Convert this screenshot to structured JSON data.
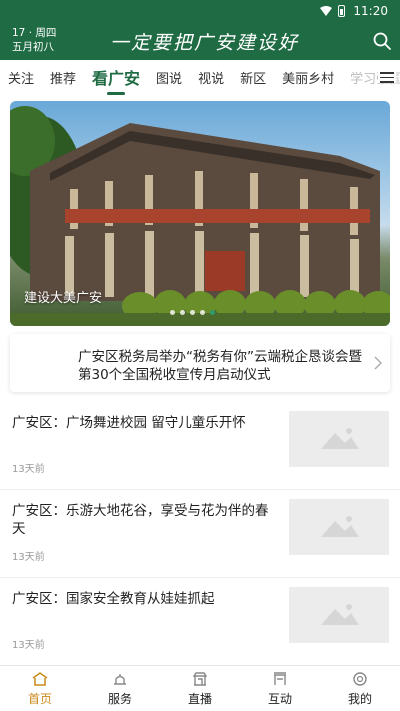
{
  "status_bar": {
    "time": "11:20"
  },
  "header": {
    "date_line1": "17 · 周四",
    "date_line2": "五月初八",
    "slogan": "一定要把广安建设好",
    "search_icon": "search-icon"
  },
  "tabs": [
    {
      "label": "关注"
    },
    {
      "label": "推荐"
    },
    {
      "label": "看广安",
      "active": true
    },
    {
      "label": "图说"
    },
    {
      "label": "视说"
    },
    {
      "label": "新区"
    },
    {
      "label": "美丽乡村"
    },
    {
      "label": "学习强国"
    }
  ],
  "banner": {
    "caption": "建设大美广安",
    "dots": 5,
    "active_dot": 4
  },
  "headline": {
    "text": "广安区税务局举办“税务有你”云端税企恳谈会暨第30个全国税收宣传月启动仪式"
  },
  "news": [
    {
      "title": "广安区：广场舞进校园  留守儿童乐开怀",
      "time": "13天前"
    },
    {
      "title": "广安区：乐游大地花谷，享受与花为伴的春天",
      "time": "13天前"
    },
    {
      "title": "广安区：国家安全教育从娃娃抓起",
      "time": "13天前"
    }
  ],
  "bottom_nav": [
    {
      "label": "首页",
      "icon": "home-icon",
      "active": true
    },
    {
      "label": "服务",
      "icon": "service-icon"
    },
    {
      "label": "直播",
      "icon": "live-icon"
    },
    {
      "label": "互动",
      "icon": "interact-icon"
    },
    {
      "label": "我的",
      "icon": "profile-icon"
    }
  ],
  "colors": {
    "brand_green": "#1f6b44",
    "active_nav": "#c98a1a"
  }
}
